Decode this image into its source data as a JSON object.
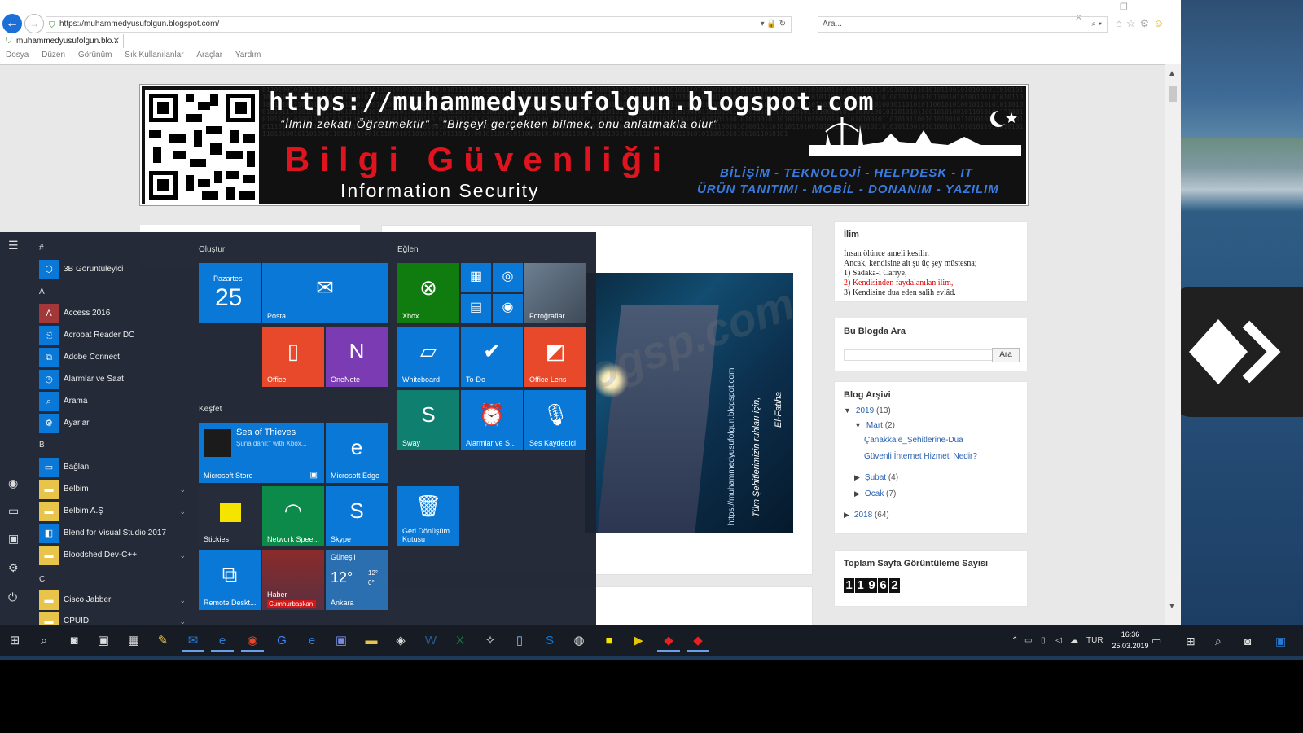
{
  "browser": {
    "url": "https://muhammedyusufolgun.blogspot.com/",
    "search_placeholder": "Ara...",
    "tab_title": "muhammedyusufolgun.blo...",
    "menu": [
      "Dosya",
      "Düzen",
      "Görünüm",
      "Sık Kullanılanlar",
      "Araçlar",
      "Yardım"
    ]
  },
  "banner": {
    "url_text": "https://muhammedyusufolgun.blogspot.com",
    "motto": "\"İlmin zekatı Öğretmektir\" - \"Birşeyi gerçekten bilmek, onu anlatmakla olur\"",
    "big_title": "Bilgi Güvenliği",
    "subtitle": "Information Security",
    "tagline1": "BİLİŞİM - TEKNOLOJİ - HELPDESK - IT",
    "tagline2": "ÜRÜN TANITIMI - MOBİL - DONANIM - YAZILIM"
  },
  "post": {
    "image_text1": "https://muhammedyusufolgun.blogspot.com",
    "image_text2": "Tüm Şehitlerimizin ruhları için,",
    "image_text3": "El-Fatiha",
    "watermark": "n.blogsp.com"
  },
  "sidebar": {
    "ilim": {
      "title": "İlim",
      "lines": [
        "İnsan ölünce ameli kesilir.",
        "Ancak, kendisine ait şu üç şey müstesna;",
        "1) Sadaka-i Cariye,",
        "2) Kendisinden faydalanılan ilim,",
        "3) Kendisine dua eden salih evlâd."
      ]
    },
    "search": {
      "title": "Bu Blogda Ara",
      "button": "Ara"
    },
    "archive": {
      "title": "Blog Arşivi",
      "y2019": "2019",
      "y2019_count": "(13)",
      "mart": "Mart",
      "mart_count": "(2)",
      "post1": "Çanakkale_Şehitlerine-Dua",
      "post2": "Güvenli İnternet Hizmeti Nedir?",
      "subat": "Şubat",
      "subat_count": "(4)",
      "ocak": "Ocak",
      "ocak_count": "(7)",
      "y2018": "2018",
      "y2018_count": "(64)"
    },
    "pageviews": {
      "title": "Toplam Sayfa Görüntüleme Sayısı",
      "digits": [
        "1",
        "1",
        "9",
        "6",
        "2"
      ]
    }
  },
  "start_menu": {
    "letters": {
      "hash": "#",
      "a": "A",
      "b": "B",
      "c": "C"
    },
    "apps": [
      "3B Görüntüleyici",
      "Access 2016",
      "Acrobat Reader DC",
      "Adobe Connect",
      "Alarmlar ve Saat",
      "Arama",
      "Ayarlar",
      "Bağlan",
      "Belbim",
      "Belbim A.Ş",
      "Blend for Visual Studio 2017",
      "Bloodshed Dev-C++",
      "Cisco Jabber",
      "CPUID"
    ],
    "groups": {
      "create": "Oluştur",
      "play": "Eğlen",
      "explore": "Keşfet"
    },
    "tiles": {
      "calendar_day": "Pazartesi",
      "calendar_date": "25",
      "mail": "Posta",
      "office": "Office",
      "onenote": "OneNote",
      "xbox": "Xbox",
      "photos": "Fotoğraflar",
      "whiteboard": "Whiteboard",
      "todo": "To-Do",
      "officelens": "Office Lens",
      "sway": "Sway",
      "alarms": "Alarmlar ve S...",
      "recorder": "Ses Kaydedici",
      "store_title": "Sea of Thieves",
      "store_sub": "Şuna dâhil:\" with Xbox...",
      "store": "Microsoft Store",
      "edge": "Microsoft Edge",
      "stickies": "Stickies",
      "network": "Network Spee...",
      "skype": "Skype",
      "recycle": "Geri Dönüşüm Kutusu",
      "remote": "Remote Deskt...",
      "news": "Haber",
      "news_sub": "Cumhurbaşkanı",
      "weather_cond": "Güneşli",
      "weather_temp": "12°",
      "weather_hi": "12°",
      "weather_lo": "0°",
      "weather_city": "Ankara"
    }
  },
  "taskbar": {
    "lang": "TUR",
    "time": "16:36",
    "date": "25.03.2019"
  },
  "colors": {
    "accent": "#1c6fd6",
    "tile_blue": "#0a78d7",
    "tile_orange": "#e8492b",
    "tile_purple": "#7b3bb3",
    "tile_green": "#107c10"
  }
}
